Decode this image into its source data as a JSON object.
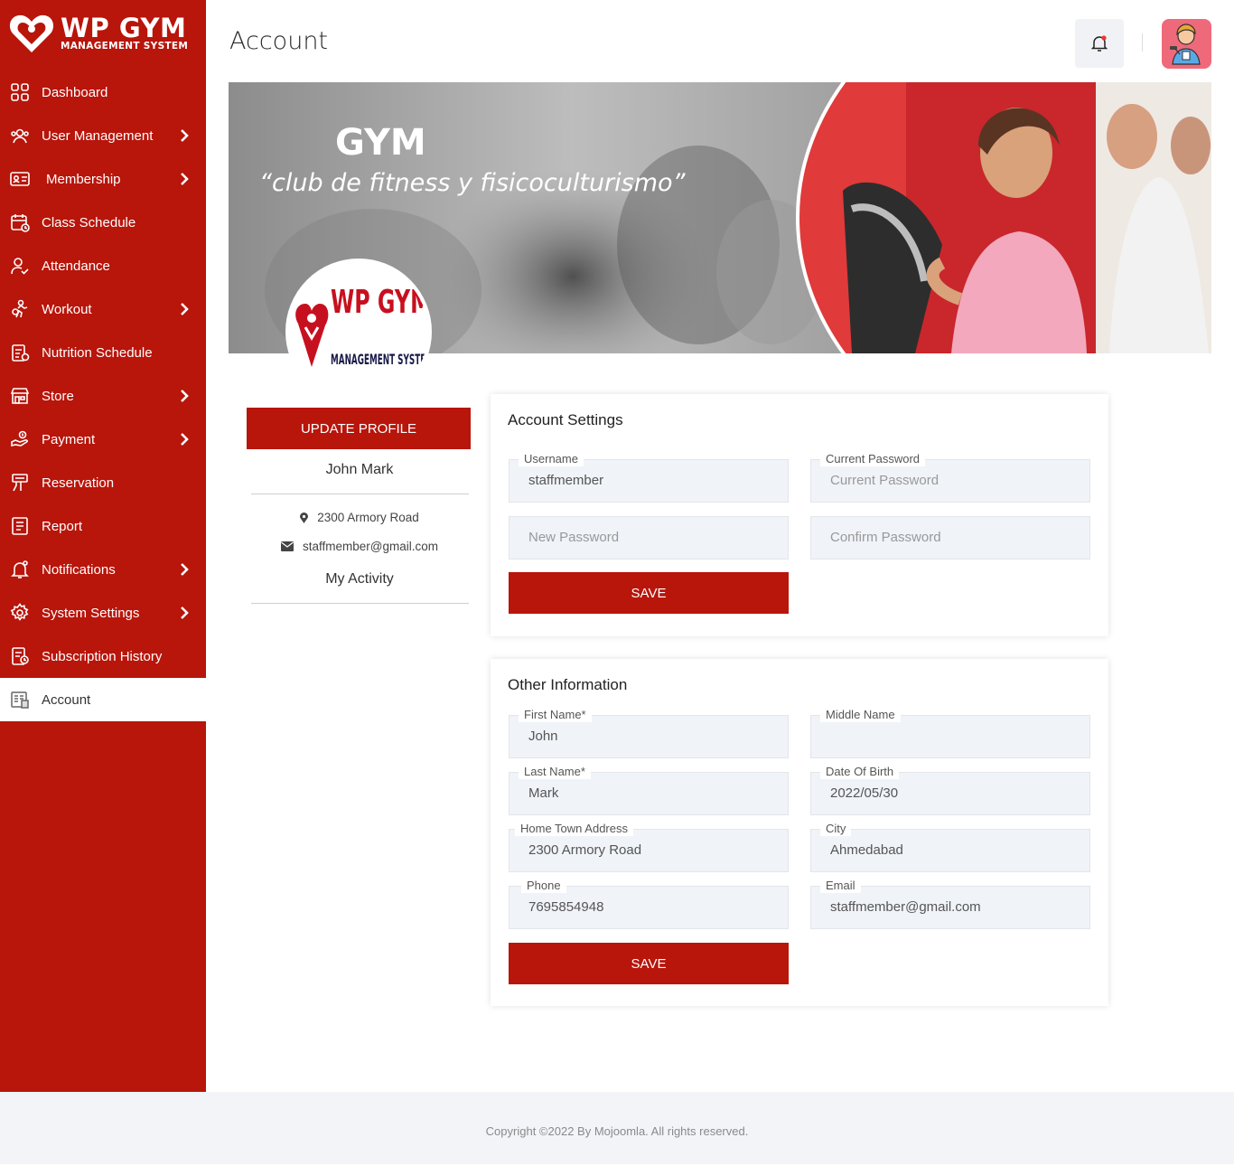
{
  "brand": {
    "title": "WP GYM",
    "subtitle": "MANAGEMENT SYSTEM"
  },
  "sidebar": {
    "items": [
      {
        "label": "Dashboard",
        "icon": "dashboard-icon",
        "chevron": false
      },
      {
        "label": "User Management",
        "icon": "users-icon",
        "chevron": true
      },
      {
        "label": "Membership",
        "icon": "membership-card-icon",
        "chevron": true
      },
      {
        "label": "Class Schedule",
        "icon": "calendar-icon",
        "chevron": false
      },
      {
        "label": "Attendance",
        "icon": "attendance-icon",
        "chevron": false
      },
      {
        "label": "Workout",
        "icon": "workout-icon",
        "chevron": true
      },
      {
        "label": "Nutrition Schedule",
        "icon": "nutrition-icon",
        "chevron": false
      },
      {
        "label": "Store",
        "icon": "store-icon",
        "chevron": true
      },
      {
        "label": "Payment",
        "icon": "payment-icon",
        "chevron": true
      },
      {
        "label": "Reservation",
        "icon": "reservation-icon",
        "chevron": false
      },
      {
        "label": "Report",
        "icon": "report-icon",
        "chevron": false
      },
      {
        "label": "Notifications",
        "icon": "notification-bell-icon",
        "chevron": true
      },
      {
        "label": "System Settings",
        "icon": "settings-gear-icon",
        "chevron": true
      },
      {
        "label": "Subscription History",
        "icon": "subscription-history-icon",
        "chevron": false
      },
      {
        "label": "Account",
        "icon": "account-icon",
        "chevron": false,
        "active": true
      }
    ]
  },
  "header": {
    "title": "Account"
  },
  "banner": {
    "title": "GYM",
    "subtitle": "“club de fitness y fisicoculturismo”"
  },
  "profile_logo": {
    "brand": "WP GYM",
    "sub": "MANAGEMENT SYSTEM"
  },
  "profile": {
    "update_label": "UPDATE PROFILE",
    "name": "John Mark",
    "address": "2300 Armory Road",
    "email": "staffmember@gmail.com",
    "activity_label": "My Activity"
  },
  "account_settings": {
    "title": "Account Settings",
    "username_label": "Username",
    "username_value": "staffmember",
    "current_password_label": "Current Password",
    "current_password_placeholder": "Current Password",
    "new_password_placeholder": "New Password",
    "confirm_password_placeholder": "Confirm Password",
    "save_label": "SAVE"
  },
  "other_info": {
    "title": "Other Information",
    "first_name_label": "First Name*",
    "first_name": "John",
    "middle_name_label": "Middle Name",
    "middle_name": "",
    "last_name_label": "Last Name*",
    "last_name": "Mark",
    "dob_label": "Date Of Birth",
    "dob": "2022/05/30",
    "address_label": "Home Town Address",
    "address": "2300 Armory Road",
    "city_label": "City",
    "city": "Ahmedabad",
    "phone_label": "Phone",
    "phone": "7695854948",
    "email_label": "Email",
    "email": "staffmember@gmail.com",
    "save_label": "SAVE"
  },
  "footer": {
    "text": "Copyright ©2022 By Mojoomla. All rights reserved."
  },
  "colors": {
    "accent": "#b8150b",
    "field_bg": "#f0f3f8",
    "footer_bg": "#f2f4f8"
  }
}
